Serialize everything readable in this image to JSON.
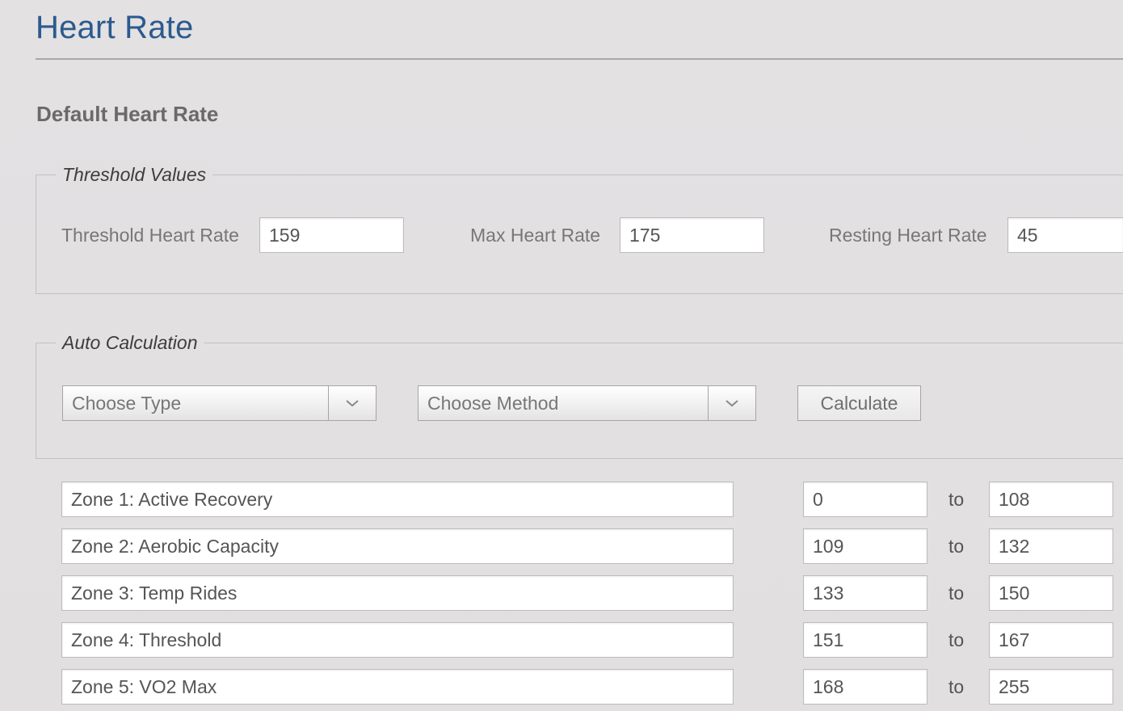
{
  "page": {
    "title": "Heart Rate",
    "section_title": "Default Heart Rate"
  },
  "threshold_values": {
    "legend": "Threshold Values",
    "threshold_label": "Threshold Heart Rate",
    "threshold_value": "159",
    "max_label": "Max Heart Rate",
    "max_value": "175",
    "resting_label": "Resting Heart Rate",
    "resting_value": "45"
  },
  "auto_calculation": {
    "legend": "Auto Calculation",
    "type_select": "Choose Type",
    "method_select": "Choose Method",
    "calculate_label": "Calculate",
    "chevron_icon": "chevron-down-icon"
  },
  "zones": [
    {
      "name": "Zone 1: Active Recovery",
      "min": "0",
      "to": "to",
      "max": "108"
    },
    {
      "name": "Zone 2: Aerobic Capacity",
      "min": "109",
      "to": "to",
      "max": "132"
    },
    {
      "name": "Zone 3: Temp Rides",
      "min": "133",
      "to": "to",
      "max": "150"
    },
    {
      "name": "Zone 4: Threshold",
      "min": "151",
      "to": "to",
      "max": "167"
    },
    {
      "name": "Zone 5: VO2 Max",
      "min": "168",
      "to": "to",
      "max": "255"
    }
  ],
  "colors": {
    "title_blue": "#2a5a8f",
    "background": "#e2e0e1",
    "input_border": "#bdbcbd"
  }
}
